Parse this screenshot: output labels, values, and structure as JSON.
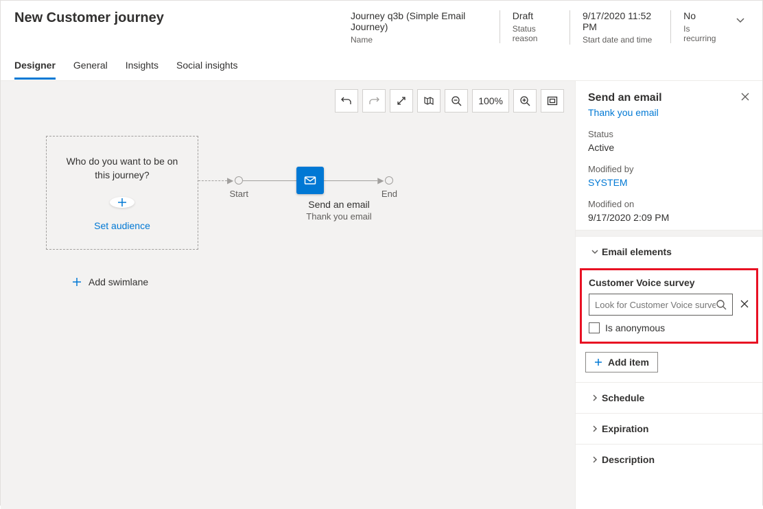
{
  "header": {
    "page_title": "New Customer journey",
    "fields": {
      "name": {
        "value": "Journey q3b (Simple Email Journey)",
        "label": "Name"
      },
      "status": {
        "value": "Draft",
        "label": "Status reason"
      },
      "start": {
        "value": "9/17/2020 11:52 PM",
        "label": "Start date and time"
      },
      "recurring": {
        "value": "No",
        "label": "Is recurring"
      }
    }
  },
  "tabs": [
    "Designer",
    "General",
    "Insights",
    "Social insights"
  ],
  "toolbar": {
    "zoom": "100%"
  },
  "journey": {
    "audience_question": "Who do you want to be on this journey?",
    "set_audience": "Set audience",
    "start_label": "Start",
    "end_label": "End",
    "email_title": "Send an email",
    "email_subtitle": "Thank you email",
    "add_swimlane": "Add swimlane"
  },
  "panel": {
    "title": "Send an email",
    "subtitle_link": "Thank you email",
    "status": {
      "label": "Status",
      "value": "Active"
    },
    "modified_by": {
      "label": "Modified by",
      "value": "SYSTEM"
    },
    "modified_on": {
      "label": "Modified on",
      "value": "9/17/2020 2:09 PM"
    },
    "sections": {
      "email_elements": "Email elements",
      "schedule": "Schedule",
      "expiration": "Expiration",
      "description": "Description"
    },
    "survey": {
      "label": "Customer Voice survey",
      "placeholder": "Look for Customer Voice survey",
      "anonymous": "Is anonymous"
    },
    "add_item": "Add item"
  }
}
